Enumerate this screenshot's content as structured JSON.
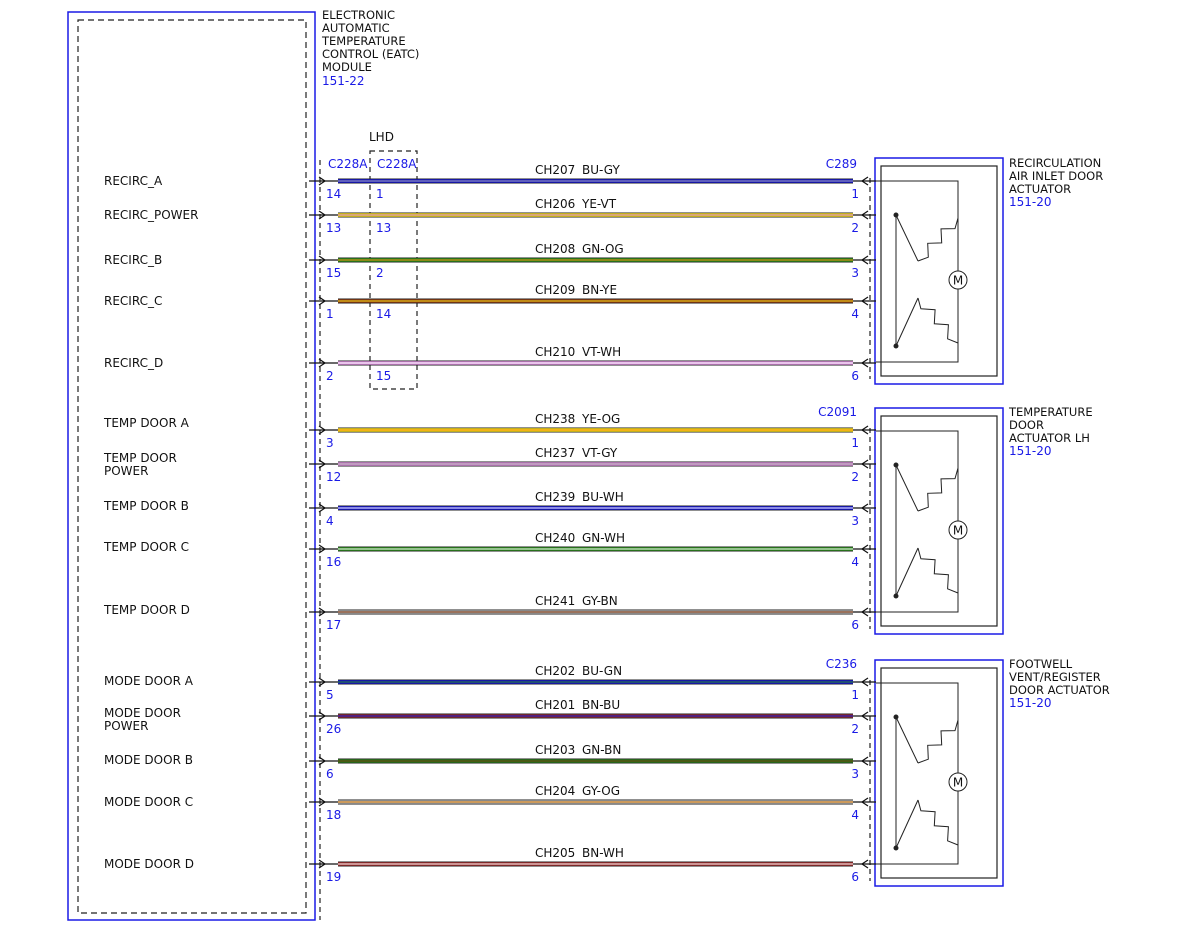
{
  "module": {
    "title_lines": [
      "ELECTRONIC",
      "AUTOMATIC",
      "TEMPERATURE",
      "CONTROL (EATC)",
      "MODULE"
    ],
    "ref": "151-22"
  },
  "connectors": {
    "module_main": "C228A",
    "module_lhd": "C228A",
    "lhd_label": "LHD"
  },
  "colors": {
    "frame_blue": "#1a1ae6",
    "ref_blue": "#1a1ae6"
  },
  "actuators": [
    {
      "title_lines": [
        "RECIRCULATION",
        "AIR INLET DOOR",
        "ACTUATOR"
      ],
      "ref": "151-20",
      "connector": "C289"
    },
    {
      "title_lines": [
        "TEMPERATURE",
        "DOOR",
        "ACTUATOR LH"
      ],
      "ref": "151-20",
      "connector": "C2091"
    },
    {
      "title_lines": [
        "FOOTWELL",
        "VENT/REGISTER",
        "DOOR ACTUATOR"
      ],
      "ref": "151-20",
      "connector": "C236"
    }
  ],
  "signals": [
    {
      "label": [
        "RECIRC_A"
      ],
      "circuit": "CH207",
      "color": "BU-GY",
      "pin_main": "14",
      "pin_lhd": "1",
      "pin_act": "1",
      "group": 0,
      "c1": "#1515d0",
      "c2": "#a9a9a9"
    },
    {
      "label": [
        "RECIRC_POWER"
      ],
      "circuit": "CH206",
      "color": "YE-VT",
      "pin_main": "13",
      "pin_lhd": "13",
      "pin_act": "2",
      "group": 0,
      "c1": "#f5dc1c",
      "c2": "#c070d0"
    },
    {
      "label": [
        "RECIRC_B"
      ],
      "circuit": "CH208",
      "color": "GN-OG",
      "pin_main": "15",
      "pin_lhd": "2",
      "pin_act": "3",
      "group": 0,
      "c1": "#2a8a1a",
      "c2": "#ee8a10"
    },
    {
      "label": [
        "RECIRC_C"
      ],
      "circuit": "CH209",
      "color": "BN-YE",
      "pin_main": "1",
      "pin_lhd": "14",
      "pin_act": "4",
      "group": 0,
      "c1": "#8b3a10",
      "c2": "#f5dc1c"
    },
    {
      "label": [
        "RECIRC_D"
      ],
      "circuit": "CH210",
      "color": "VT-WH",
      "pin_main": "2",
      "pin_lhd": "15",
      "pin_act": "6",
      "group": 0,
      "c1": "#d68ad8",
      "c2": "#ffffff"
    },
    {
      "label": [
        "TEMP DOOR A"
      ],
      "circuit": "CH238",
      "color": "YE-OG",
      "pin_main": "3",
      "pin_lhd": "",
      "pin_act": "1",
      "group": 1,
      "c1": "#f5dc1c",
      "c2": "#ee8a10"
    },
    {
      "label": [
        "TEMP DOOR",
        "POWER"
      ],
      "circuit": "CH237",
      "color": "VT-GY",
      "pin_main": "12",
      "pin_lhd": "",
      "pin_act": "2",
      "group": 1,
      "c1": "#d68ad8",
      "c2": "#a9a9a9"
    },
    {
      "label": [
        "TEMP DOOR B"
      ],
      "circuit": "CH239",
      "color": "BU-WH",
      "pin_main": "4",
      "pin_lhd": "",
      "pin_act": "3",
      "group": 1,
      "c1": "#1515d0",
      "c2": "#ffffff"
    },
    {
      "label": [
        "TEMP DOOR C"
      ],
      "circuit": "CH240",
      "color": "GN-WH",
      "pin_main": "16",
      "pin_lhd": "",
      "pin_act": "4",
      "group": 1,
      "c1": "#2a8a1a",
      "c2": "#ffffff"
    },
    {
      "label": [
        "TEMP DOOR D"
      ],
      "circuit": "CH241",
      "color": "GY-BN",
      "pin_main": "17",
      "pin_lhd": "",
      "pin_act": "6",
      "group": 1,
      "c1": "#a9a9a9",
      "c2": "#8b3a10"
    },
    {
      "label": [
        "MODE DOOR A"
      ],
      "circuit": "CH202",
      "color": "BU-GN",
      "pin_main": "5",
      "pin_lhd": "",
      "pin_act": "1",
      "group": 2,
      "c1": "#1515d0",
      "c2": "#2a8a1a"
    },
    {
      "label": [
        "MODE DOOR",
        "POWER"
      ],
      "circuit": "CH201",
      "color": "BN-BU",
      "pin_main": "26",
      "pin_lhd": "",
      "pin_act": "2",
      "group": 2,
      "c1": "#8b2a30",
      "c2": "#1515d0"
    },
    {
      "label": [
        "MODE DOOR B"
      ],
      "circuit": "CH203",
      "color": "GN-BN",
      "pin_main": "6",
      "pin_lhd": "",
      "pin_act": "3",
      "group": 2,
      "c1": "#2a7a1a",
      "c2": "#6b3a10"
    },
    {
      "label": [
        "MODE DOOR C"
      ],
      "circuit": "CH204",
      "color": "GY-OG",
      "pin_main": "18",
      "pin_lhd": "",
      "pin_act": "4",
      "group": 2,
      "c1": "#a9a9a9",
      "c2": "#ee8a10"
    },
    {
      "label": [
        "MODE DOOR D"
      ],
      "circuit": "CH205",
      "color": "BN-WH",
      "pin_main": "19",
      "pin_lhd": "",
      "pin_act": "6",
      "group": 2,
      "c1": "#9b2a2a",
      "c2": "#ffffff"
    }
  ]
}
